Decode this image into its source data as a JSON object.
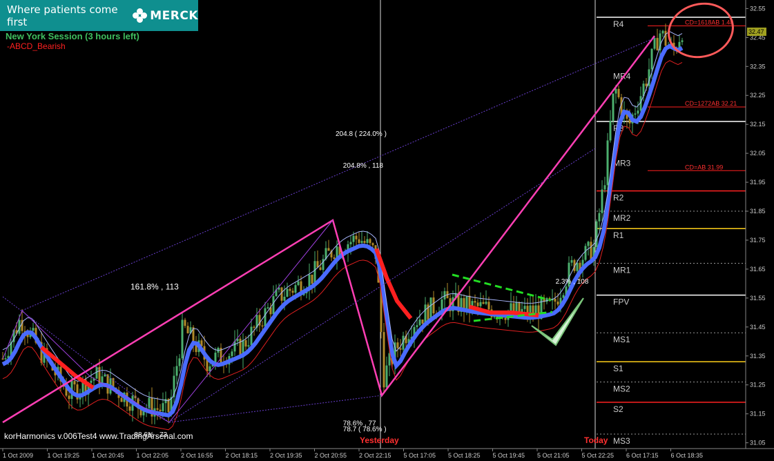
{
  "banner": {
    "tagline": "Where patients come first",
    "brand": "MERCK"
  },
  "session": "New York Session (3 hours left)",
  "indicator": "-ABCD_Bearish",
  "footer": "korHarmonics v.006Test4 www.TradingArsenal.com",
  "markers": {
    "yesterday": "Yesterday",
    "today": "Today"
  },
  "colors": {
    "up": "#4caf6e",
    "down": "#b08a2a",
    "pattern": "#ff3fb4",
    "wedge": "#22dd22",
    "bg": "#000000"
  },
  "chart_data": {
    "type": "candlestick",
    "ylim": [
      31.03,
      32.57
    ],
    "y_ticks": [
      "32.55",
      "32.45",
      "32.35",
      "32.25",
      "32.15",
      "32.05",
      "31.95",
      "31.85",
      "31.75",
      "31.65",
      "31.55",
      "31.45",
      "31.35",
      "31.25",
      "31.15",
      "31.05"
    ],
    "x_ticks": [
      "1 Oct 2009",
      "1 Oct 19:25",
      "1 Oct 20:45",
      "1 Oct 22:05",
      "2 Oct 16:55",
      "2 Oct 18:15",
      "2 Oct 19:35",
      "2 Oct 20:55",
      "2 Oct 22:15",
      "5 Oct 17:05",
      "5 Oct 18:25",
      "5 Oct 19:45",
      "5 Oct 21:05",
      "5 Oct 22:25",
      "6 Oct 17:15",
      "6 Oct 18:35"
    ],
    "current_price": "32.47",
    "pivots": [
      {
        "label": "R4",
        "value": 32.52,
        "color": "#ffffff"
      },
      {
        "label": "MR4",
        "value": 32.34,
        "color": "none"
      },
      {
        "label": "R3",
        "value": 32.16,
        "color": "#ffffff"
      },
      {
        "label": "MR3",
        "value": 32.04,
        "color": "none"
      },
      {
        "label": "R2",
        "value": 31.92,
        "color": "#ff2020"
      },
      {
        "label": "MR2",
        "value": 31.85,
        "color": "dotted"
      },
      {
        "label": "R1",
        "value": 31.79,
        "color": "#ffd11a"
      },
      {
        "label": "MR1",
        "value": 31.67,
        "color": "dotted"
      },
      {
        "label": "FPV",
        "value": 31.56,
        "color": "#ffffff"
      },
      {
        "label": "MS1",
        "value": 31.43,
        "color": "dotted"
      },
      {
        "label": "S1",
        "value": 31.33,
        "color": "#ffd11a"
      },
      {
        "label": "MS2",
        "value": 31.26,
        "color": "dotted"
      },
      {
        "label": "S2",
        "value": 31.19,
        "color": "#ff2020"
      },
      {
        "label": "MS3",
        "value": 31.08,
        "color": "dotted"
      }
    ],
    "cd_levels": [
      {
        "label": "CD=1618AB",
        "value_text": "1.48",
        "value": 32.49
      },
      {
        "label": "CD=1272AB",
        "value_text": "32.21",
        "value": 32.21
      },
      {
        "label": "CD=AB",
        "value_text": "31.99",
        "value": 31.99
      }
    ],
    "annotations": [
      {
        "text": "161.8% , 113",
        "x": 0.175,
        "y": 31.58
      },
      {
        "text": "204.8 ( 224.0% )",
        "x": 0.45,
        "y": 32.11
      },
      {
        "text": "204.8% , 118",
        "x": 0.46,
        "y": 32.0
      },
      {
        "text": "78.6% , 77",
        "x": 0.46,
        "y": 31.11
      },
      {
        "text": "78.7 ( 78.6% )",
        "x": 0.46,
        "y": 31.09
      },
      {
        "text": "88.6% , 73",
        "x": 0.18,
        "y": 31.07
      },
      {
        "text": "2.3% , 108",
        "x": 0.745,
        "y": 31.6
      }
    ],
    "pattern_points": [
      {
        "x": 0.0,
        "y": 31.12
      },
      {
        "x": 0.431,
        "y": 31.82
      },
      {
        "x": 0.494,
        "y": 31.2
      },
      {
        "x": 0.845,
        "y": 32.5
      }
    ]
  }
}
